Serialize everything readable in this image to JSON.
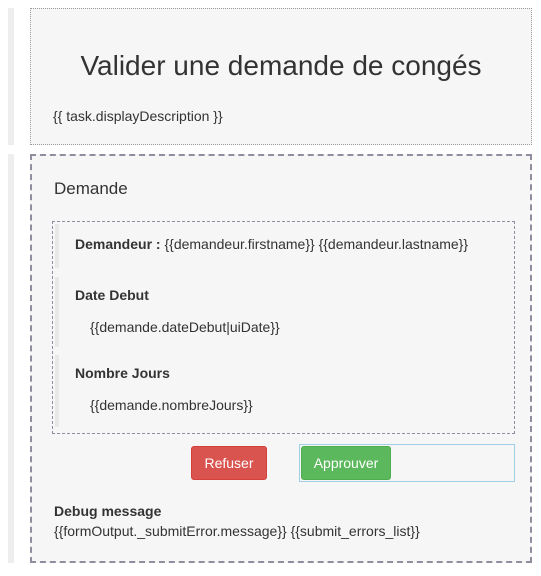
{
  "header": {
    "title": "Valider une demande de congés",
    "task_description": "{{ task.displayDescription }}"
  },
  "form": {
    "section_title": "Demande",
    "fields": {
      "demandeur": {
        "label": "Demandeur :",
        "value": "{{demandeur.firstname}} {{demandeur.lastname}}"
      },
      "date_debut": {
        "label": "Date Debut",
        "value": "{{demande.dateDebut|uiDate}}"
      },
      "nombre_jours": {
        "label": "Nombre Jours",
        "value": "{{demande.nombreJours}}"
      }
    },
    "buttons": {
      "refuse_label": "Refuser",
      "approve_label": "Approuver"
    },
    "debug": {
      "title": "Debug message",
      "message": "{{formOutput._submitError.message}} {{submit_errors_list}}"
    }
  },
  "colors": {
    "refuse_button": "#d9534f",
    "approve_button": "#5cb85c",
    "container_background": "#f6f6f6",
    "dashed_border": "#8e8e9e"
  }
}
